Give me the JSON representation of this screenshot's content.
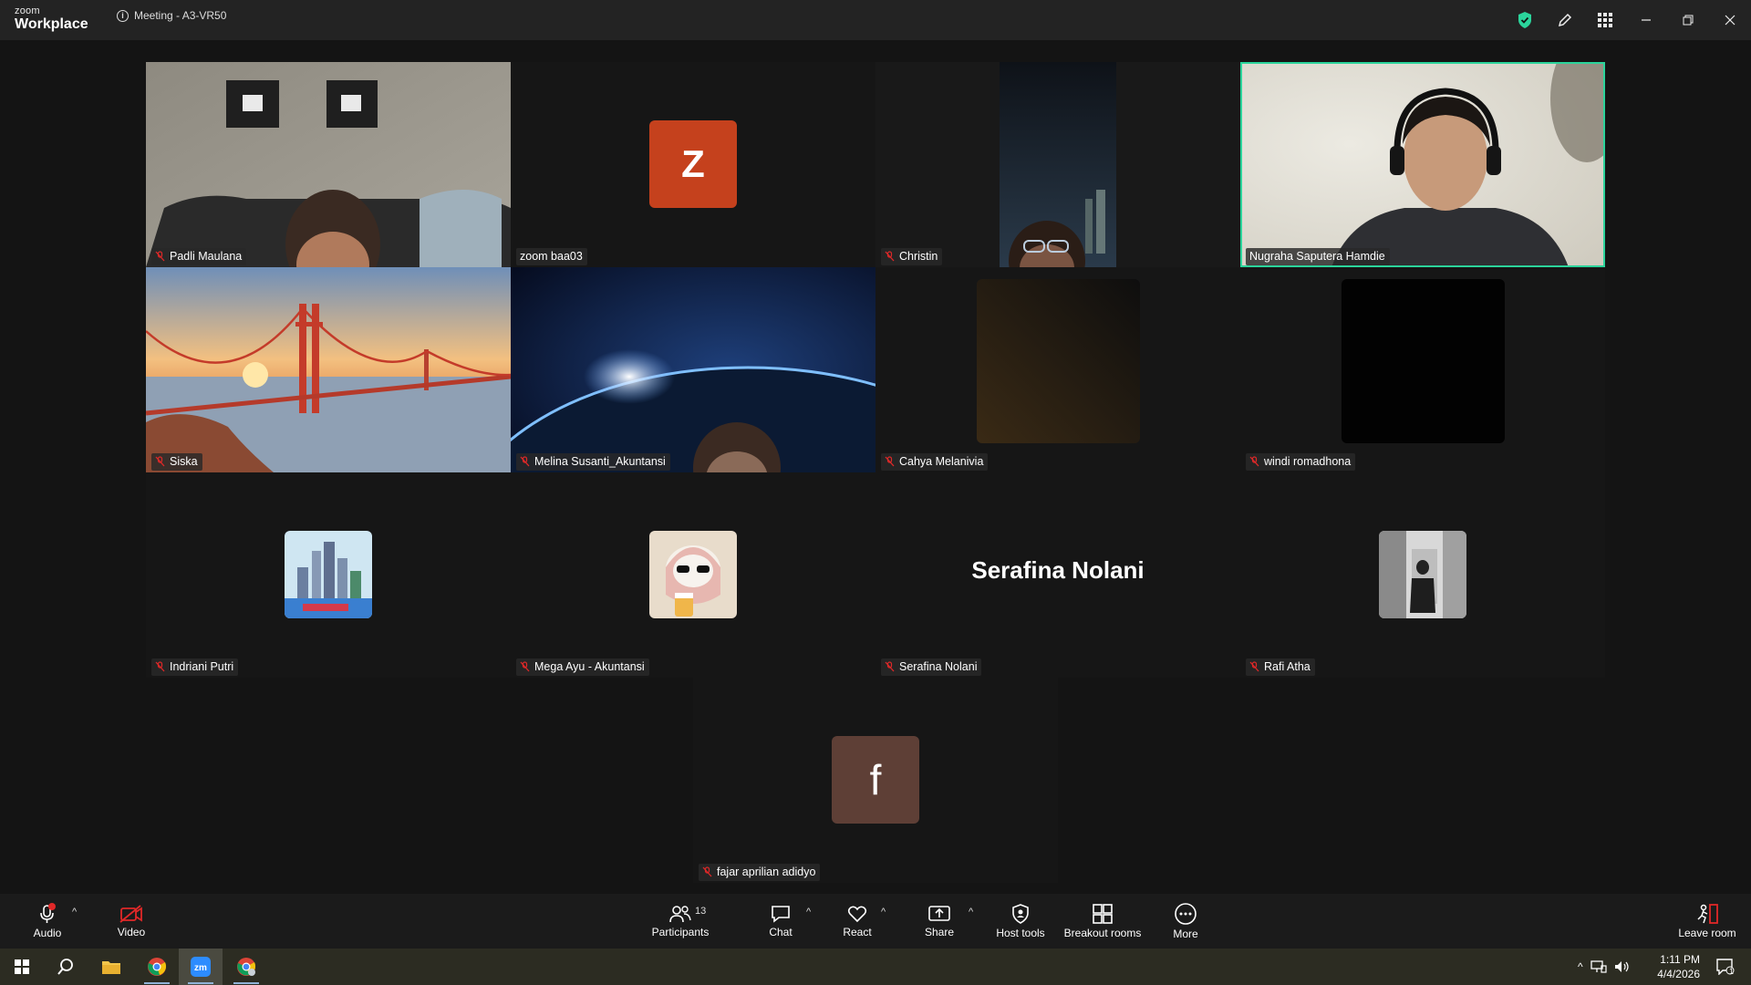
{
  "app": {
    "brand_small": "zoom",
    "brand_big": "Workplace",
    "meeting_title": "Meeting - A3-VR50"
  },
  "participants": [
    {
      "name": "Padli Maulana",
      "muted": true
    },
    {
      "name": "zoom baa03",
      "muted": false,
      "avatar_letter": "Z",
      "avatar_color": "#c5411d"
    },
    {
      "name": "Christin",
      "muted": true
    },
    {
      "name": "Nugraha Saputera Hamdie",
      "muted": false,
      "speaking": true
    },
    {
      "name": "Siska",
      "muted": true
    },
    {
      "name": "Melina Susanti_Akuntansi",
      "muted": true
    },
    {
      "name": "Cahya Melanivia",
      "muted": true
    },
    {
      "name": "windi romadhona",
      "muted": true
    },
    {
      "name": "Indriani Putri",
      "muted": true
    },
    {
      "name": "Mega Ayu - Akuntansi",
      "muted": true
    },
    {
      "name": "Serafina Nolani",
      "muted": true,
      "display_name": "Serafina Nolani"
    },
    {
      "name": "Rafi Atha",
      "muted": true
    },
    {
      "name": "fajar aprilian adidyo",
      "muted": true,
      "avatar_letter": "f",
      "avatar_color": "#5e3f36"
    }
  ],
  "toolbar": {
    "audio": "Audio",
    "video": "Video",
    "participants": "Participants",
    "participants_count": "13",
    "chat": "Chat",
    "react": "React",
    "share": "Share",
    "host_tools": "Host tools",
    "breakout_rooms": "Breakout rooms",
    "more": "More",
    "leave_room": "Leave room"
  },
  "taskbar": {
    "time": "1:11 PM",
    "date": "4/4/2026",
    "notification_count": "1"
  },
  "colors": {
    "speaking_outline": "#2bd49b",
    "shield": "#2bd49b",
    "muted_red": "#e02828"
  }
}
